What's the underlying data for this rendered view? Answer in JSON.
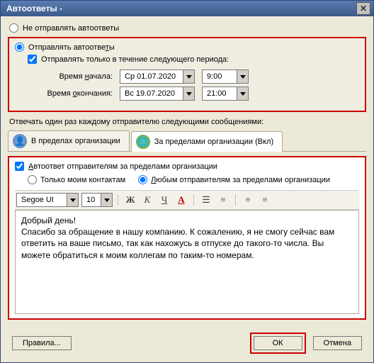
{
  "title": "Автоответы -",
  "radios": {
    "no_send": "Не отправлять автоответы",
    "send": "Отправлять автоответы"
  },
  "period_chk": "Отправлять только в течение следующего периода:",
  "start_label": "Время начала:",
  "end_label": "Время окончания:",
  "start_date": "Ср 01.07.2020",
  "start_time": "9:00",
  "end_date": "Вс 19.07.2020",
  "end_time": "21:00",
  "instr": "Отвечать один раз каждому отправителю следующими сообщениями:",
  "tabs": {
    "inside": "В пределах организации",
    "outside": "За пределами организации (Вкл)"
  },
  "ext": {
    "chk": "Автоответ отправителям за пределами организации",
    "contacts_only": "Только моим контактам",
    "any_sender": "Любым отправителям за пределами организации"
  },
  "font": {
    "name": "Segoe UI",
    "size": "10"
  },
  "msg_l1": "Добрый день!",
  "msg_l2": "Спасибо за обращение в нашу компанию. К сожалению, я не смогу сейчас вам ответить на ваше письмо, так как нахожусь в отпуске до такого-то числа. Вы можете обратиться к моим коллегам по таким-то номерам.",
  "buttons": {
    "rules": "Правила...",
    "ok": "ОК",
    "cancel": "Отмена"
  }
}
